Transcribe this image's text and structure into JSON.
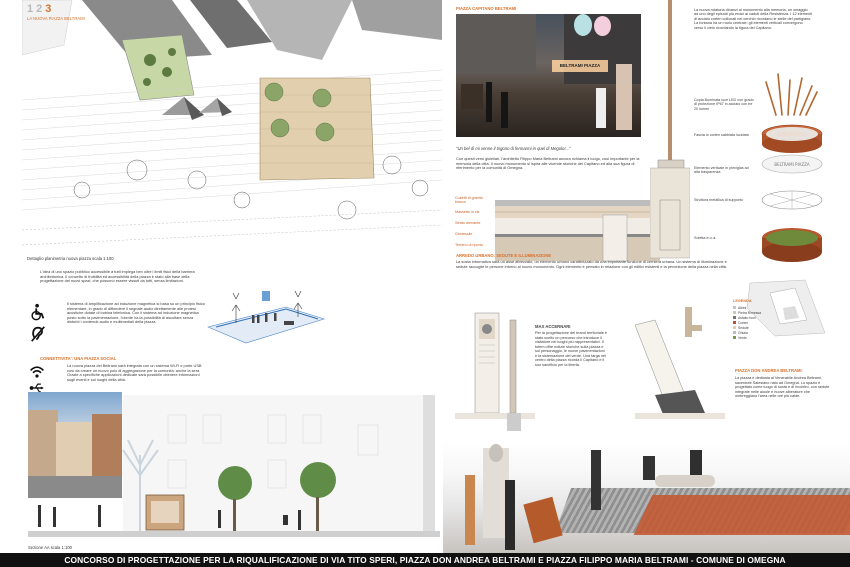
{
  "sheet": {
    "page_numbers": [
      "1",
      "2",
      "3"
    ],
    "active_page": "3",
    "section_title": "LA NUOVA PIAZZA BELTRAMI",
    "footer_title": "CONCORSO DI PROGETTAZIONE PER LA RIQUALIFICAZIONE DI VIA TITO SPERI, PIAZZA DON ANDREA BELTRAMI E PIAZZA FILIPPO MARIA BELTRAMI - COMUNE DI OMEGNA"
  },
  "plan": {
    "caption": "Dettaglio planimetria nuova piazza scala 1:100",
    "section_caption": "Sezione AA scala 1:100"
  },
  "accessibility": {
    "intro": "L'idea di uno spazio pubblico accessibile a tutti impiega ben oltre i limiti fisici della barriera architettonica. Il concetto di fruibilità ed accessibilità della piazza è stato alla base della progettazione dei nuovi spazi, che possono essere vissuti da tutti, senza limitazioni.",
    "body": "Il sistema di amplificazione ad induzione magnetica si basa su un principio fisico elementare, in grado di diffondere il segnale audio direttamente alle protesi acustiche dotate di bobina telefonica. Con il sistema ad induzione magnetica posto sotto la pavimentazione, l'utente ha la possibilità di ascoltare senza disturbi i contenuti audio e multimediali della piazza.",
    "wifi_heading": "CONNETTIVITA': UNA PIAZZA SOCIAL",
    "wifi_body": "La nuova piazza del Beltrami sarà integrata con un sistema Wi-Fi e porte USB così da creare un nuovo polo di aggregazione per la comunità, anche la sera. Grazie a specifiche applicazioni dedicate sarà possibile ottenere informazioni sugli eventi e sui luoghi della città."
  },
  "photo_caption": {
    "heading": "PIAZZA CAPITANO BELTRAMI",
    "quote": "\"Un bel dì mi venne il trigono di fermarmi in quel di Megolo!...\"",
    "body": "Con questi versi gioiellari, l'architetto Filippo Maria Beltrami ancora richiama il luogo, così importante per la memoria della città. Il nuovo monumento si ispira alle vicende storiche del Capitano ed alla sua figura di riferimento per la comunità di Omegna.",
    "sign_text": "BELTRAMI PIAZZA"
  },
  "section_labels": [
    "Cubetti di granito bianco",
    "Massetto in cls",
    "Strato drenante",
    "Geotessile",
    "Terreno di riporto"
  ],
  "monument": {
    "intro": "La nuova rotatoria dinanzi al monumento alla memoria, un omaggio ad uno degli episodi più eroici ai caduti della Resistenza. I 12 elementi di acciaio corten collocati nel cerchio ricordano le stelle del partigiano. La fontana ha un ruolo centrale: gli elementi verticali convergono verso il cielo ricordando la figura del Capitano.",
    "labels": [
      "Copia illuminata luce LED con grado di protezione IP67 in acciaio con tre 20 lumen",
      "Fascia in corten sabbiata lucidata",
      "Elemento verticale in plexiglas ad alta trasparenza",
      "Struttura metallica di supporto",
      "Soletta in c.a."
    ],
    "ring_text_top": "DON ANDREA",
    "ring_text_bottom": "BELTRAMI PIAZZA"
  },
  "legend": {
    "heading": "LEGENDA",
    "items": [
      "Albini",
      "Pietra Rimessa",
      "Asfalto fuori",
      "Corten",
      "Sedute",
      "Ghiaia",
      "Verde"
    ]
  },
  "plaques": {
    "left_heading": "MAX ACCERNARI",
    "left_body": "Per la progettazione del brand territoriale è stato scelto un percorso che introduce il visitatore nei luoghi più rappresentativi. Il totem offre notizie storiche sulla piazza e sul personaggio, le nuove pavimentazioni e la sistemazione del verde. Una targa nel centro della piazza ricorda il Capitano e il suo sacrificio per la libertà.",
    "right_heading": "PIAZZA DON ANDREA BELTRAMI",
    "right_body": "La piazza è dedicata al Venerabile Andrea Beltrami, sacerdote Salesiano nato ad Omegna. Lo spazio è progettato come luogo di sosta e di incontro, con sedute integrate nelle aiuole e nuove alberature che ombreggiano l'area nelle ore più calde."
  },
  "urban_text": {
    "heading": "ARREDO URBANO: SEDUTE E ILLUMINAZIONE",
    "body": "La sosta informativa sarà un asse attrezzato, un elemento urbano caratterizzato da una importante funzione di cerniera urbana. Un sistema di illuminazione e sedute raccoglie le persone intorno al nuovo monumento. Ogni elemento è pensato in relazione con gli edifici esistenti e la percezione della piazza nella città."
  }
}
